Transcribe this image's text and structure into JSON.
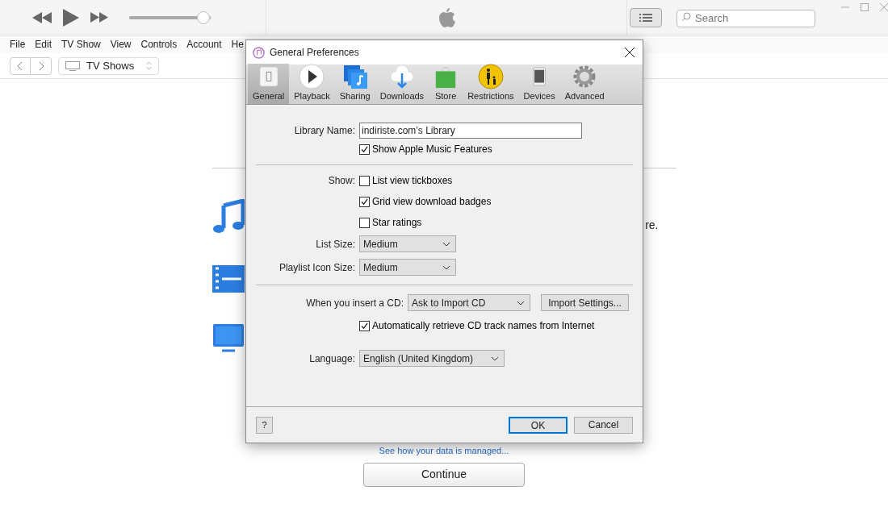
{
  "player": {
    "volume": {
      "level": 0.9
    }
  },
  "menu": [
    "File",
    "Edit",
    "TV Show",
    "View",
    "Controls",
    "Account",
    "He"
  ],
  "nav": {
    "source": "TV Shows"
  },
  "search": {
    "placeholder": "Search"
  },
  "background": {
    "partial_text": "re.",
    "link": "See how your data is managed...",
    "continue": "Continue"
  },
  "dialog": {
    "title": "General Preferences",
    "tabs": [
      {
        "label": "General",
        "selected": true
      },
      {
        "label": "Playback",
        "selected": false
      },
      {
        "label": "Sharing",
        "selected": false
      },
      {
        "label": "Downloads",
        "selected": false
      },
      {
        "label": "Store",
        "selected": false
      },
      {
        "label": "Restrictions",
        "selected": false
      },
      {
        "label": "Devices",
        "selected": false
      },
      {
        "label": "Advanced",
        "selected": false
      }
    ],
    "library_name": {
      "label": "Library Name:",
      "value": "indiriste.com’s Library"
    },
    "apple_music": {
      "label": "Show Apple Music Features",
      "checked": true
    },
    "show": {
      "label": "Show:",
      "options": [
        {
          "label": "List view tickboxes",
          "checked": false
        },
        {
          "label": "Grid view download badges",
          "checked": true
        },
        {
          "label": "Star ratings",
          "checked": false
        }
      ]
    },
    "list_size": {
      "label": "List Size:",
      "value": "Medium"
    },
    "playlist_icon_size": {
      "label": "Playlist Icon Size:",
      "value": "Medium"
    },
    "cd": {
      "label": "When you insert a CD:",
      "value": "Ask to Import CD",
      "button": "Import Settings..."
    },
    "auto_retrieve": {
      "label": "Automatically retrieve CD track names from Internet",
      "checked": true
    },
    "language": {
      "label": "Language:",
      "value": "English (United Kingdom)"
    },
    "help": "?",
    "ok": "OK",
    "cancel": "Cancel"
  }
}
